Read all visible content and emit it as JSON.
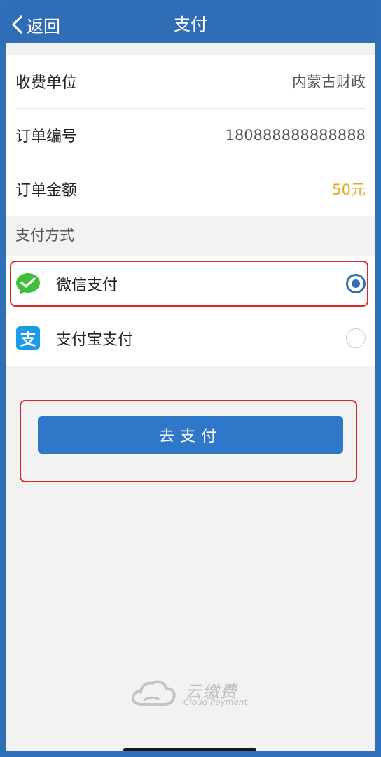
{
  "nav": {
    "back_label": "返回",
    "title": "支付"
  },
  "info": {
    "rows": [
      {
        "label": "收费单位",
        "value": "内蒙古财政"
      },
      {
        "label": "订单编号",
        "value": "180888888888888"
      },
      {
        "label": "订单金额",
        "value": "50元"
      }
    ]
  },
  "payment": {
    "section_title": "支付方式",
    "methods": [
      {
        "name": "微信支付",
        "icon": "wechat-pay-icon",
        "selected": true
      },
      {
        "name": "支付宝支付",
        "icon": "alipay-icon",
        "selected": false
      }
    ]
  },
  "action": {
    "pay_label": "去支付"
  },
  "footer": {
    "brand_cn": "云缴费",
    "brand_en": "Cloud Payment"
  },
  "colors": {
    "primary": "#2f6db6",
    "amount": "#e9a51f",
    "wechat": "#3fbf3a",
    "alipay": "#1e9be8",
    "highlight": "#d9272a"
  }
}
